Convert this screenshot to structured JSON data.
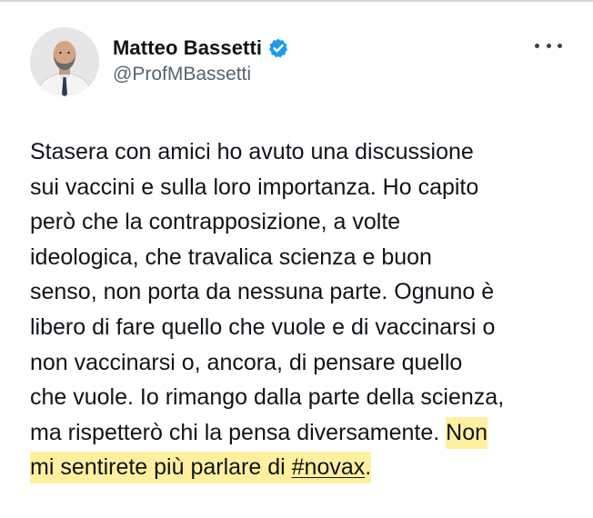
{
  "tweet": {
    "author": {
      "name": "Matteo Bassetti",
      "handle": "@ProfMBassetti",
      "verified": true,
      "verified_color": "#1d9bf0"
    },
    "text_plain": "Stasera con amici ho avuto una discussione\nsui vaccini e sulla loro importanza. Ho capito\nperò che la contrapposizione, a volte\nideologica, che travalica scienza e buon\nsenso, non porta da nessuna parte. Ognuno è\nlibero di fare quello che vuole e di vaccinarsi o\nnon vaccinarsi o, ancora, di pensare quello\nche vuole. Io rimango dalla parte della scienza,\nma rispetterò chi la pensa diversamente. ",
    "text_highlight_1": "Non",
    "text_highlight_2": "mi sentirete più parlare di ",
    "hashtag": "#novax",
    "text_highlight_end": ".",
    "highlight_color": "#fff0a0",
    "more_icon": "ellipsis-icon"
  }
}
